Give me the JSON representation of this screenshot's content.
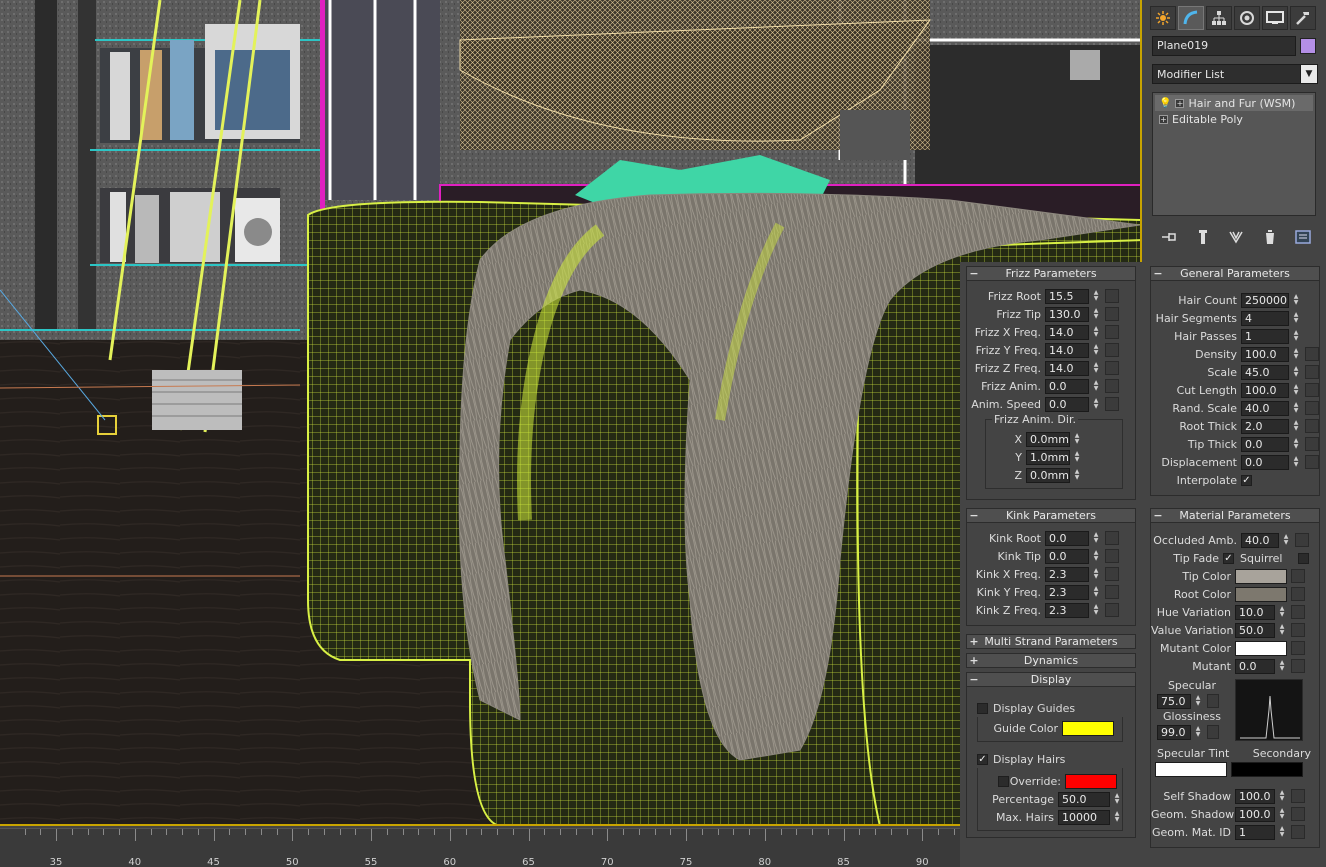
{
  "object_name": "Plane019",
  "object_color": "#b48fe6",
  "modifier_list_label": "Modifier List",
  "stack": [
    {
      "label": "Hair and Fur (WSM)",
      "selected": true
    },
    {
      "label": "Editable Poly",
      "selected": false
    }
  ],
  "command_tabs": [
    "create-icon",
    "modify-icon",
    "hierarchy-icon",
    "motion-icon",
    "display-icon",
    "utilities-icon"
  ],
  "tools": [
    "pin-stack-icon",
    "show-end-result-icon",
    "make-unique-icon",
    "remove-modifier-icon",
    "configure-modifier-sets-icon"
  ],
  "timeline_ticks": [
    "35",
    "40",
    "45",
    "50",
    "55",
    "60",
    "65",
    "70",
    "75",
    "80",
    "85",
    "90"
  ],
  "frizz": {
    "title": "Frizz Parameters",
    "rows": [
      {
        "label": "Frizz Root",
        "value": "15.5"
      },
      {
        "label": "Frizz Tip",
        "value": "130.0"
      },
      {
        "label": "Frizz X Freq.",
        "value": "14.0"
      },
      {
        "label": "Frizz Y Freq.",
        "value": "14.0"
      },
      {
        "label": "Frizz Z Freq.",
        "value": "14.0"
      },
      {
        "label": "Frizz Anim.",
        "value": "0.0"
      },
      {
        "label": "Anim. Speed",
        "value": "0.0"
      }
    ],
    "anim_dir": {
      "title": "Frizz Anim. Dir.",
      "rows": [
        {
          "label": "X",
          "value": "0.0mm"
        },
        {
          "label": "Y",
          "value": "1.0mm"
        },
        {
          "label": "Z",
          "value": "0.0mm"
        }
      ]
    }
  },
  "kink": {
    "title": "Kink Parameters",
    "rows": [
      {
        "label": "Kink Root",
        "value": "0.0"
      },
      {
        "label": "Kink Tip",
        "value": "0.0"
      },
      {
        "label": "Kink X Freq.",
        "value": "2.3"
      },
      {
        "label": "Kink Y Freq.",
        "value": "2.3"
      },
      {
        "label": "Kink Z Freq.",
        "value": "2.3"
      }
    ]
  },
  "multi_strand_title": "Multi Strand Parameters",
  "dynamics_title": "Dynamics",
  "display": {
    "title": "Display",
    "display_guides_label": "Display Guides",
    "display_guides_checked": false,
    "guide_color_label": "Guide Color",
    "guide_color": "#ffff00",
    "display_hairs_label": "Display Hairs",
    "display_hairs_checked": true,
    "override_label": "Override:",
    "override_checked": false,
    "override_color": "#ff0000",
    "percentage_label": "Percentage",
    "percentage_value": "50.0",
    "max_hairs_label": "Max. Hairs",
    "max_hairs_value": "10000"
  },
  "general": {
    "title": "General Parameters",
    "rows": [
      {
        "label": "Hair Count",
        "value": "250000"
      },
      {
        "label": "Hair Segments",
        "value": "4"
      },
      {
        "label": "Hair Passes",
        "value": "1"
      },
      {
        "label": "Density",
        "value": "100.0"
      },
      {
        "label": "Scale",
        "value": "45.0"
      },
      {
        "label": "Cut Length",
        "value": "100.0"
      },
      {
        "label": "Rand. Scale",
        "value": "40.0"
      },
      {
        "label": "Root Thick",
        "value": "2.0"
      },
      {
        "label": "Tip Thick",
        "value": "0.0"
      },
      {
        "label": "Displacement",
        "value": "0.0"
      }
    ],
    "interpolate_label": "Interpolate",
    "interpolate_checked": true
  },
  "material": {
    "title": "Material Parameters",
    "occluded_label": "Occluded Amb.",
    "occluded_value": "40.0",
    "tip_fade_label": "Tip Fade",
    "tip_fade_checked": true,
    "squirrel_label": "Squirrel",
    "squirrel_checked": false,
    "tip_color_label": "Tip Color",
    "tip_color": "#a8a39b",
    "root_color_label": "Root Color",
    "root_color": "#7d786e",
    "hue_variation_label": "Hue Variation",
    "hue_variation_value": "10.0",
    "value_variation_label": "Value Variation",
    "value_variation_value": "50.0",
    "mutant_color_label": "Mutant Color",
    "mutant_color": "#ffffff",
    "mutant_label": "Mutant",
    "mutant_value": "0.0",
    "specular_label": "Specular",
    "specular_value": "75.0",
    "glossiness_label": "Glossiness",
    "glossiness_value": "99.0",
    "specular_tint_label": "Specular Tint",
    "specular_tint": "#ffffff",
    "secondary_label": "Secondary",
    "secondary_color": "#000000",
    "self_shadow_label": "Self Shadow",
    "self_shadow_value": "100.0",
    "geom_shadow_label": "Geom. Shadow",
    "geom_shadow_value": "100.0",
    "geom_mat_id_label": "Geom. Mat. ID",
    "geom_mat_id_value": "1"
  }
}
